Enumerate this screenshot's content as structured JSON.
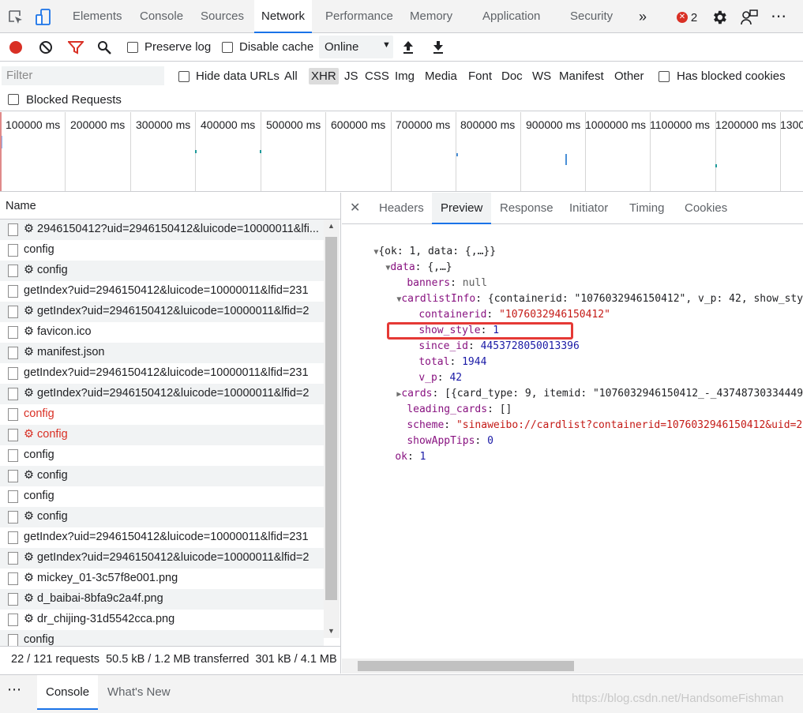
{
  "top_tabs": [
    "Elements",
    "Console",
    "Sources",
    "Network",
    "Performance",
    "Memory",
    "Application",
    "Security"
  ],
  "more_tabs": "»",
  "error_count": "2",
  "toolbar": {
    "preserve_log": "Preserve log",
    "disable_cache": "Disable cache",
    "throttle": "Online"
  },
  "filter": {
    "placeholder": "Filter",
    "hide_data_urls": "Hide data URLs",
    "types": [
      "All",
      "XHR",
      "JS",
      "CSS",
      "Img",
      "Media",
      "Font",
      "Doc",
      "WS",
      "Manifest",
      "Other"
    ],
    "selected_type": "XHR",
    "has_blocked_cookies": "Has blocked cookies",
    "blocked_requests": "Blocked Requests"
  },
  "overview_ticks": [
    "100000 ms",
    "200000 ms",
    "300000 ms",
    "400000 ms",
    "500000 ms",
    "600000 ms",
    "700000 ms",
    "800000 ms",
    "900000 ms",
    "1000000 ms",
    "1100000 ms",
    "1200000 ms",
    "1300"
  ],
  "requests": {
    "column": "Name",
    "rows": [
      {
        "name": "⚙ 2946150412?uid=2946150412&luicode=10000011&lfi...",
        "red": false
      },
      {
        "name": "config",
        "red": false
      },
      {
        "name": "⚙ config",
        "red": false
      },
      {
        "name": "getIndex?uid=2946150412&luicode=10000011&lfid=231",
        "red": false
      },
      {
        "name": "⚙ getIndex?uid=2946150412&luicode=10000011&lfid=2",
        "red": false
      },
      {
        "name": "⚙ favicon.ico",
        "red": false
      },
      {
        "name": "⚙ manifest.json",
        "red": false
      },
      {
        "name": "getIndex?uid=2946150412&luicode=10000011&lfid=231",
        "red": false
      },
      {
        "name": "⚙ getIndex?uid=2946150412&luicode=10000011&lfid=2",
        "red": false
      },
      {
        "name": "config",
        "red": true
      },
      {
        "name": "⚙ config",
        "red": true
      },
      {
        "name": "config",
        "red": false
      },
      {
        "name": "⚙ config",
        "red": false
      },
      {
        "name": "config",
        "red": false
      },
      {
        "name": "⚙ config",
        "red": false
      },
      {
        "name": "getIndex?uid=2946150412&luicode=10000011&lfid=231",
        "red": false
      },
      {
        "name": "⚙ getIndex?uid=2946150412&luicode=10000011&lfid=2",
        "red": false
      },
      {
        "name": "⚙ mickey_01-3c57f8e001.png",
        "red": false
      },
      {
        "name": "⚙ d_baibai-8bfa9c2a4f.png",
        "red": false
      },
      {
        "name": "⚙ dr_chijing-31d5542cca.png",
        "red": false
      },
      {
        "name": "config",
        "red": false
      }
    ],
    "status": "22 / 121 requests  50.5 kB / 1.2 MB transferred  301 kB / 4.1 MB"
  },
  "detail_tabs": [
    "Headers",
    "Preview",
    "Response",
    "Initiator",
    "Timing",
    "Cookies"
  ],
  "active_detail_tab": "Preview",
  "preview": {
    "root": "{ok: 1, data: {,…}}",
    "data_summary": "{,…}",
    "banners": "null",
    "cardlistInfo_summary": "{containerid: \"1076032946150412\", v_p: 42, show_sty",
    "containerid": "\"1076032946150412\"",
    "show_style": "1",
    "since_id": "4453728050013396",
    "total": "1944",
    "v_p": "42",
    "cards_summary": "[{card_type: 9, itemid: \"1076032946150412_-_43748730334449",
    "leading_cards": "[]",
    "scheme": "\"sinaweibo://cardlist?containerid=1076032946150412&uid=29",
    "showAppTips": "0",
    "ok": "1"
  },
  "drawer_tabs": [
    "Console",
    "What's New"
  ],
  "watermark": "https://blog.csdn.net/HandsomeFishman"
}
